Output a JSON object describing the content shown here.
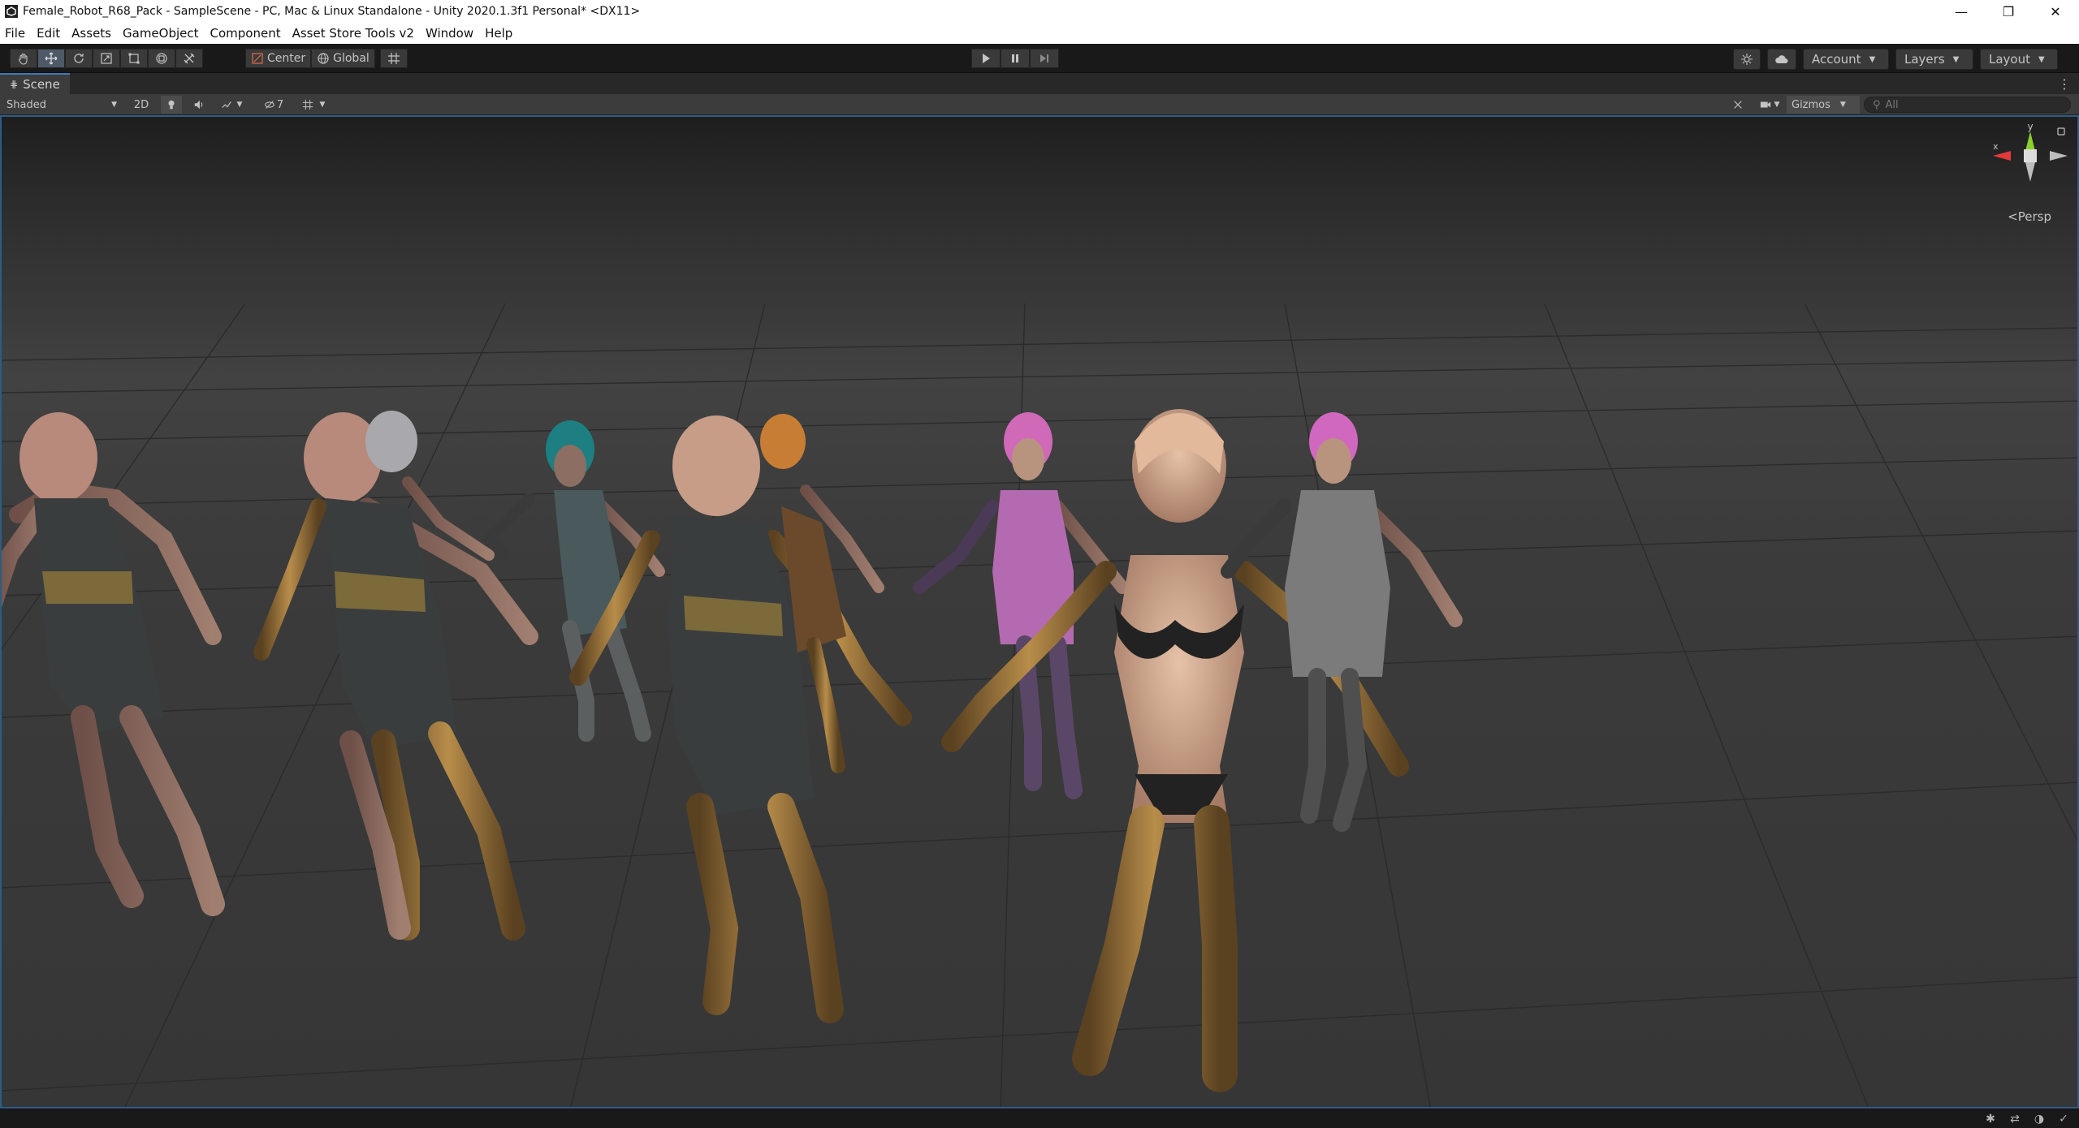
{
  "window": {
    "title": "Female_Robot_R68_Pack - SampleScene - PC, Mac & Linux Standalone - Unity 2020.1.3f1 Personal* <DX11>",
    "minimize_glyph": "—",
    "maximize_glyph": "❐",
    "close_glyph": "✕"
  },
  "menu": [
    "File",
    "Edit",
    "Assets",
    "GameObject",
    "Component",
    "Asset Store Tools v2",
    "Window",
    "Help"
  ],
  "toolbar": {
    "tools": [
      "hand-tool",
      "move-tool",
      "rotate-tool",
      "scale-tool",
      "rect-tool",
      "transform-tool",
      "custom-tool"
    ],
    "active_tool": "move-tool",
    "pivot_label": "Center",
    "space_label": "Global",
    "account_label": "Account",
    "layers_label": "Layers",
    "layout_label": "Layout"
  },
  "scene_tab": {
    "label": "Scene"
  },
  "scene_toolbar": {
    "shading_mode": "Shaded",
    "mode_2d_label": "2D",
    "hidden_count": "7",
    "gizmos_label": "Gizmos",
    "search_placeholder": "All"
  },
  "viewport": {
    "projection_label": "Persp",
    "axis_y_label": "y",
    "axis_x_label": "x",
    "colors": {
      "selection_border": "#2c5d87",
      "axis_x": "#e23a3a",
      "axis_y": "#8ad02e",
      "axis_z": "#3a6fe2"
    },
    "characters": [
      {
        "name": "robot-dark-dress-1",
        "hair": "#b98b7a",
        "dress": "#3a3d3e"
      },
      {
        "name": "robot-dark-dress-2",
        "hair": "#b98b7a",
        "dress": "#3a3d3e"
      },
      {
        "name": "robot-silver-hair",
        "hair": "#a9a9ad",
        "dress": "#6d6a66"
      },
      {
        "name": "robot-teal-hair",
        "hair": "#1d7f82",
        "dress": "#49595c"
      },
      {
        "name": "robot-dark-dress-3",
        "hair": "#b98b7a",
        "dress": "#3a3d3e"
      },
      {
        "name": "robot-orange-hair",
        "hair": "#c77d33",
        "dress": "#6b4a2c"
      },
      {
        "name": "robot-pink-dress",
        "hair": "#d069b8",
        "dress": "#b46ab0"
      },
      {
        "name": "robot-bikini",
        "hair": "#e2b99a",
        "dress": "#222222"
      },
      {
        "name": "robot-grey-dress",
        "hair": "#d168bf",
        "dress": "#7b7b7b"
      }
    ]
  }
}
